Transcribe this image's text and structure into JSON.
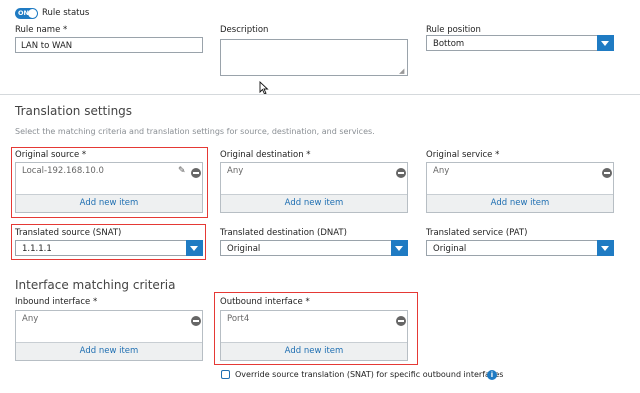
{
  "rule_status": {
    "toggle": "ON",
    "label": "Rule status"
  },
  "rule_name": {
    "label": "Rule name *",
    "value": "LAN to WAN"
  },
  "description": {
    "label": "Description",
    "value": ""
  },
  "rule_position": {
    "label": "Rule position",
    "value": "Bottom"
  },
  "translation": {
    "title": "Translation settings",
    "subtitle": "Select the matching criteria and translation settings for source, destination, and services.",
    "original_source": {
      "label": "Original source *",
      "value": "Local-192.168.10.0",
      "add": "Add new item"
    },
    "original_destination": {
      "label": "Original destination *",
      "value": "Any",
      "add": "Add new item"
    },
    "original_service": {
      "label": "Original service *",
      "value": "Any",
      "add": "Add new item"
    },
    "translated_source": {
      "label": "Translated source (SNAT)",
      "value": "1.1.1.1"
    },
    "translated_destination": {
      "label": "Translated destination (DNAT)",
      "value": "Original"
    },
    "translated_service": {
      "label": "Translated service (PAT)",
      "value": "Original"
    }
  },
  "interface": {
    "title": "Interface matching criteria",
    "inbound": {
      "label": "Inbound interface *",
      "value": "Any",
      "add": "Add new item"
    },
    "outbound": {
      "label": "Outbound interface *",
      "value": "Port4",
      "add": "Add new item"
    },
    "override_label": "Override source translation (SNAT) for specific outbound interfaces"
  },
  "colors": {
    "accent": "#1f7bc3",
    "highlight": "#e53935",
    "link": "#1f6fb2"
  }
}
